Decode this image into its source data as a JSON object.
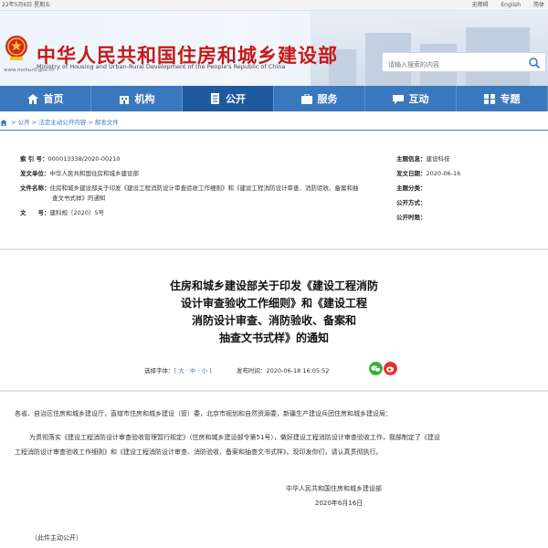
{
  "topbar": {
    "date": "22年5月6日 星期五",
    "links": [
      "无障碍",
      "English",
      "简体"
    ]
  },
  "header": {
    "title": "中华人民共和国住房和城乡建设部",
    "subtitle": "Ministry of Housing and Urban-Rural Development of the People's Republic of China",
    "url": "www.mohurd.gov.cn",
    "search_placeholder": "请输入搜索的内容"
  },
  "nav": {
    "items": [
      "首页",
      "机构",
      "公开",
      "服务",
      "互动",
      "专题"
    ],
    "active": "公开"
  },
  "breadcrumb": {
    "items": [
      "公开",
      "法定主动公开内容",
      "部发文件"
    ],
    "separator": " > "
  },
  "meta": {
    "index_label": "索 引 号：",
    "index_value": "000013338/2020-00210",
    "issuer_label": "发文单位：",
    "issuer_value": "中华人民共和国住房和城乡建设部",
    "filename_label": "文件名称：",
    "filename_value_1": "住房和城乡建设部关于印发《建设工程消防设计审查验收工作细则》和《建设工程消防设计审查、消防验收、备案和抽",
    "filename_value_2": "查文书式样》的通知",
    "docno_label": "文　　号：",
    "docno_value": "建科规〔2020〕5号",
    "topic_label": "主题信息：",
    "topic_value": "建设科技",
    "date_label": "发文日期：",
    "date_value": "2020-06-16",
    "cat_label_1": "主题分类：",
    "cat_label_2": "公开方式：",
    "cat_label_3": "公开时限："
  },
  "doc": {
    "title_lines": [
      "住房和城乡建设部关于印发《建设工程消防",
      "设计审查验收工作细则》和《建设工程",
      "消防设计审查、消防验收、备案和",
      "抽查文书式样》的通知"
    ],
    "font_label": "选择字体：",
    "font_sizes": "[ 大 · 中 · 小 ]",
    "publish_label": "发布时间：",
    "publish_value": "2020-06-18 16:05:52"
  },
  "content": {
    "p1": "各省、自治区住房和城乡建设厅，直辖市住房和城乡建设（管）委，北京市规划和自然资源委，新疆生产建设兵团住房和城乡建设局：",
    "p2a": "为贯彻落实《建设工程消防设计审查验收管理暂行规定》（住房和城乡建设部令第51号），做好建设工程消防设计审查验收工作，我部制定了《建设",
    "p2b": "工程消防设计审查验收工作细则》和《建设工程消防设计审查、消防验收、备案和抽查文书式样》。现印发你们，请认真贯彻执行。",
    "signer": "中华人民共和国住房和城乡建设部",
    "sign_date": "2020年6月16日",
    "disclosure": "（此件主动公开）"
  },
  "colors": {
    "brand_red": "#c41a1a",
    "nav_blue": "#3a78bd",
    "nav_active": "#1f5a9e"
  }
}
